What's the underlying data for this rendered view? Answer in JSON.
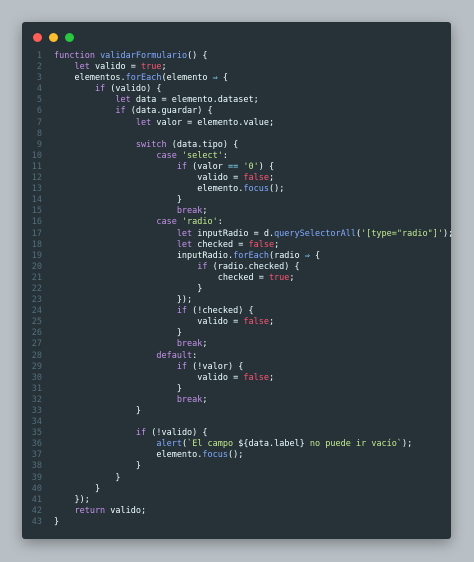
{
  "window": {
    "controls": [
      "close",
      "minimize",
      "maximize"
    ]
  },
  "code": {
    "language": "javascript",
    "lines": [
      {
        "n": "1",
        "t": [
          {
            "c": "kw",
            "s": "function "
          },
          {
            "c": "fn",
            "s": "validarFormulario"
          },
          {
            "c": "",
            "s": "() {"
          }
        ]
      },
      {
        "n": "2",
        "t": [
          {
            "c": "kw",
            "s": "    let "
          },
          {
            "c": "",
            "s": "valido = "
          },
          {
            "c": "bool",
            "s": "true"
          },
          {
            "c": "",
            "s": ";"
          }
        ]
      },
      {
        "n": "3",
        "t": [
          {
            "c": "",
            "s": "    elementos."
          },
          {
            "c": "fn",
            "s": "forEach"
          },
          {
            "c": "",
            "s": "(elemento "
          },
          {
            "c": "op",
            "s": "⇒"
          },
          {
            "c": "",
            "s": " {"
          }
        ]
      },
      {
        "n": "4",
        "t": [
          {
            "c": "kw",
            "s": "        if "
          },
          {
            "c": "",
            "s": "(valido) {"
          }
        ]
      },
      {
        "n": "5",
        "t": [
          {
            "c": "kw",
            "s": "            let "
          },
          {
            "c": "",
            "s": "data = elemento.dataset;"
          }
        ]
      },
      {
        "n": "6",
        "t": [
          {
            "c": "kw",
            "s": "            if "
          },
          {
            "c": "",
            "s": "(data.guardar) {"
          }
        ]
      },
      {
        "n": "7",
        "t": [
          {
            "c": "kw",
            "s": "                let "
          },
          {
            "c": "",
            "s": "valor = elemento.value;"
          }
        ]
      },
      {
        "n": "8",
        "t": [
          {
            "c": "",
            "s": ""
          }
        ]
      },
      {
        "n": "9",
        "t": [
          {
            "c": "kw",
            "s": "                switch "
          },
          {
            "c": "",
            "s": "(data.tipo) {"
          }
        ]
      },
      {
        "n": "10",
        "t": [
          {
            "c": "kw",
            "s": "                    case "
          },
          {
            "c": "str",
            "s": "'select'"
          },
          {
            "c": "",
            "s": ":"
          }
        ]
      },
      {
        "n": "11",
        "t": [
          {
            "c": "kw",
            "s": "                        if "
          },
          {
            "c": "",
            "s": "(valor "
          },
          {
            "c": "op",
            "s": "=="
          },
          {
            "c": "",
            "s": " "
          },
          {
            "c": "str",
            "s": "'0'"
          },
          {
            "c": "",
            "s": ") {"
          }
        ]
      },
      {
        "n": "12",
        "t": [
          {
            "c": "",
            "s": "                            valido = "
          },
          {
            "c": "bool",
            "s": "false"
          },
          {
            "c": "",
            "s": ";"
          }
        ]
      },
      {
        "n": "13",
        "t": [
          {
            "c": "",
            "s": "                            elemento."
          },
          {
            "c": "fn",
            "s": "focus"
          },
          {
            "c": "",
            "s": "();"
          }
        ]
      },
      {
        "n": "14",
        "t": [
          {
            "c": "",
            "s": "                        }"
          }
        ]
      },
      {
        "n": "15",
        "t": [
          {
            "c": "kw",
            "s": "                        break"
          },
          {
            "c": "",
            "s": ";"
          }
        ]
      },
      {
        "n": "16",
        "t": [
          {
            "c": "kw",
            "s": "                    case "
          },
          {
            "c": "str",
            "s": "'radio'"
          },
          {
            "c": "",
            "s": ":"
          }
        ]
      },
      {
        "n": "17",
        "t": [
          {
            "c": "kw",
            "s": "                        let "
          },
          {
            "c": "",
            "s": "inputRadio = d."
          },
          {
            "c": "fn",
            "s": "querySelectorAll"
          },
          {
            "c": "",
            "s": "("
          },
          {
            "c": "str",
            "s": "'[type=\"radio\"]'"
          },
          {
            "c": "",
            "s": ");"
          }
        ]
      },
      {
        "n": "18",
        "t": [
          {
            "c": "kw",
            "s": "                        let "
          },
          {
            "c": "",
            "s": "checked = "
          },
          {
            "c": "bool",
            "s": "false"
          },
          {
            "c": "",
            "s": ";"
          }
        ]
      },
      {
        "n": "19",
        "t": [
          {
            "c": "",
            "s": "                        inputRadio."
          },
          {
            "c": "fn",
            "s": "forEach"
          },
          {
            "c": "",
            "s": "(radio "
          },
          {
            "c": "op",
            "s": "⇒"
          },
          {
            "c": "",
            "s": " {"
          }
        ]
      },
      {
        "n": "20",
        "t": [
          {
            "c": "kw",
            "s": "                            if "
          },
          {
            "c": "",
            "s": "(radio.checked) {"
          }
        ]
      },
      {
        "n": "21",
        "t": [
          {
            "c": "",
            "s": "                                checked = "
          },
          {
            "c": "bool",
            "s": "true"
          },
          {
            "c": "",
            "s": ";"
          }
        ]
      },
      {
        "n": "22",
        "t": [
          {
            "c": "",
            "s": "                            }"
          }
        ]
      },
      {
        "n": "23",
        "t": [
          {
            "c": "",
            "s": "                        });"
          }
        ]
      },
      {
        "n": "24",
        "t": [
          {
            "c": "kw",
            "s": "                        if "
          },
          {
            "c": "",
            "s": "(!checked) {"
          }
        ]
      },
      {
        "n": "25",
        "t": [
          {
            "c": "",
            "s": "                            valido = "
          },
          {
            "c": "bool",
            "s": "false"
          },
          {
            "c": "",
            "s": ";"
          }
        ]
      },
      {
        "n": "26",
        "t": [
          {
            "c": "",
            "s": "                        }"
          }
        ]
      },
      {
        "n": "27",
        "t": [
          {
            "c": "kw",
            "s": "                        break"
          },
          {
            "c": "",
            "s": ";"
          }
        ]
      },
      {
        "n": "28",
        "t": [
          {
            "c": "kw",
            "s": "                    default"
          },
          {
            "c": "",
            "s": ":"
          }
        ]
      },
      {
        "n": "29",
        "t": [
          {
            "c": "kw",
            "s": "                        if "
          },
          {
            "c": "",
            "s": "(!valor) {"
          }
        ]
      },
      {
        "n": "30",
        "t": [
          {
            "c": "",
            "s": "                            valido = "
          },
          {
            "c": "bool",
            "s": "false"
          },
          {
            "c": "",
            "s": ";"
          }
        ]
      },
      {
        "n": "31",
        "t": [
          {
            "c": "",
            "s": "                        }"
          }
        ]
      },
      {
        "n": "32",
        "t": [
          {
            "c": "kw",
            "s": "                        break"
          },
          {
            "c": "",
            "s": ";"
          }
        ]
      },
      {
        "n": "33",
        "t": [
          {
            "c": "",
            "s": "                }"
          }
        ]
      },
      {
        "n": "34",
        "t": [
          {
            "c": "",
            "s": ""
          }
        ]
      },
      {
        "n": "35",
        "t": [
          {
            "c": "kw",
            "s": "                if "
          },
          {
            "c": "",
            "s": "(!valido) {"
          }
        ]
      },
      {
        "n": "36",
        "t": [
          {
            "c": "",
            "s": "                    "
          },
          {
            "c": "fn",
            "s": "alert"
          },
          {
            "c": "",
            "s": "("
          },
          {
            "c": "str",
            "s": "`El campo "
          },
          {
            "c": "",
            "s": "${data.label}"
          },
          {
            "c": "str",
            "s": " no puede ir vacío`"
          },
          {
            "c": "",
            "s": ");"
          }
        ]
      },
      {
        "n": "37",
        "t": [
          {
            "c": "",
            "s": "                    elemento."
          },
          {
            "c": "fn",
            "s": "focus"
          },
          {
            "c": "",
            "s": "();"
          }
        ]
      },
      {
        "n": "38",
        "t": [
          {
            "c": "",
            "s": "                }"
          }
        ]
      },
      {
        "n": "39",
        "t": [
          {
            "c": "",
            "s": "            }"
          }
        ]
      },
      {
        "n": "40",
        "t": [
          {
            "c": "",
            "s": "        }"
          }
        ]
      },
      {
        "n": "41",
        "t": [
          {
            "c": "",
            "s": "    });"
          }
        ]
      },
      {
        "n": "42",
        "t": [
          {
            "c": "kw",
            "s": "    return "
          },
          {
            "c": "",
            "s": "valido;"
          }
        ]
      },
      {
        "n": "43",
        "t": [
          {
            "c": "",
            "s": "}"
          }
        ]
      }
    ]
  }
}
